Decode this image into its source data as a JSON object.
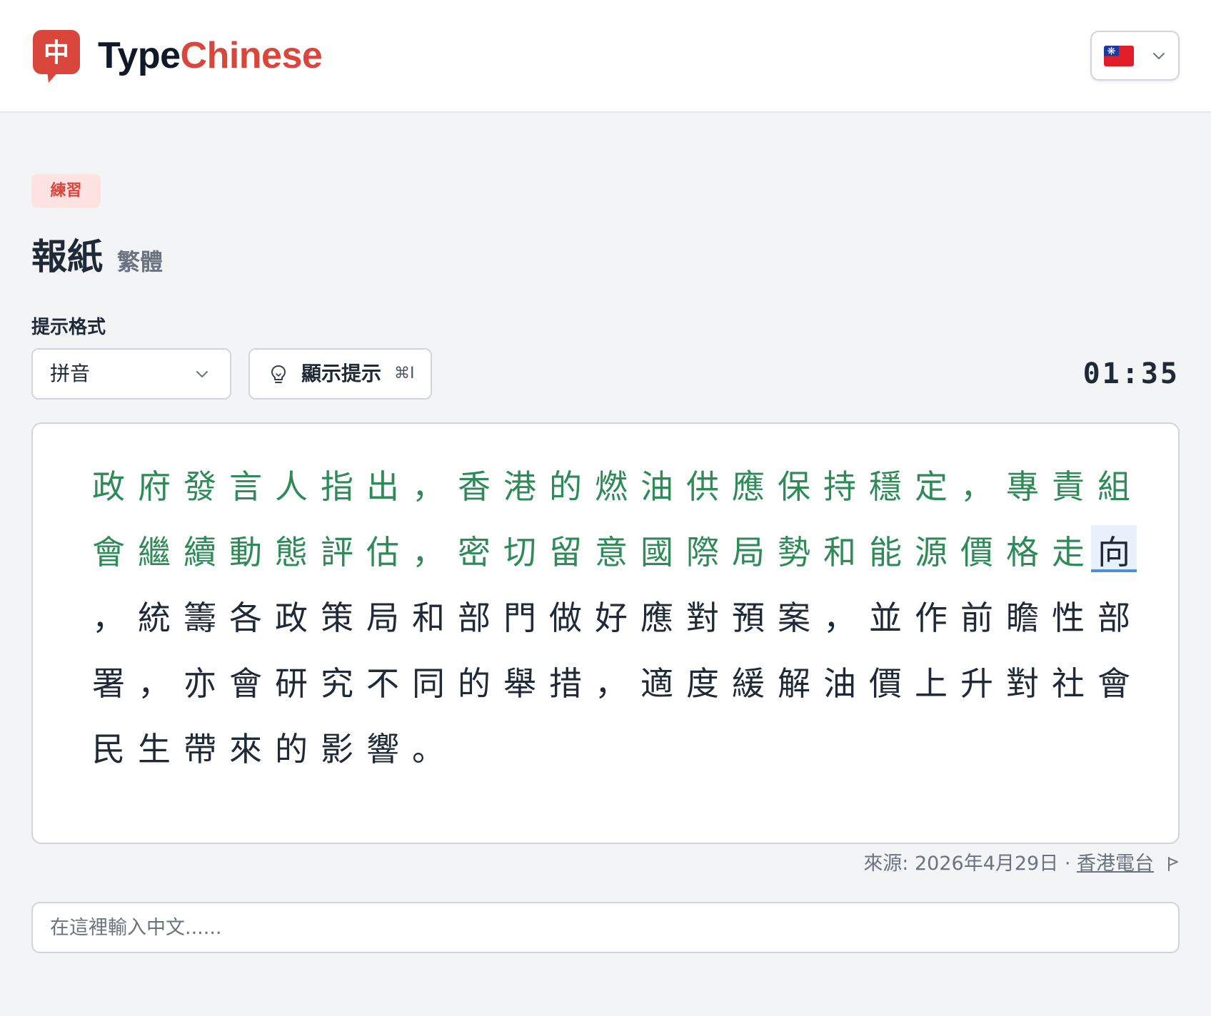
{
  "app": {
    "logo_glyph": "中",
    "name_part1": "Type",
    "name_part2": "Chinese",
    "brand_color": "#d9463b"
  },
  "language_selector": {
    "flag": "taiwan-flag-icon"
  },
  "badge": "練習",
  "title": "報紙",
  "subtitle": "繁體",
  "hint_format": {
    "label": "提示格式",
    "selected": "拼音"
  },
  "hint_button": {
    "label": "顯示提示",
    "shortcut": "⌘I"
  },
  "timer": "01:35",
  "passage": {
    "typed_color": "#2e8b57",
    "current_index": 45,
    "chars": [
      "政",
      "府",
      "發",
      "言",
      "人",
      "指",
      "出",
      "，",
      "香",
      "港",
      "的",
      "燃",
      "油",
      "供",
      "應",
      "保",
      "持",
      "穩",
      "定",
      "，",
      "專",
      "責",
      "組",
      "會",
      "繼",
      "續",
      "動",
      "態",
      "評",
      "估",
      "，",
      "密",
      "切",
      "留",
      "意",
      "國",
      "際",
      "局",
      "勢",
      "和",
      "能",
      "源",
      "價",
      "格",
      "走",
      "向",
      "，",
      "統",
      "籌",
      "各",
      "政",
      "策",
      "局",
      "和",
      "部",
      "門",
      "做",
      "好",
      "應",
      "對",
      "預",
      "案",
      "，",
      "並",
      "作",
      "前",
      "瞻",
      "性",
      "部",
      "署",
      "，",
      "亦",
      "會",
      "研",
      "究",
      "不",
      "同",
      "的",
      "舉",
      "措",
      "，",
      "適",
      "度",
      "緩",
      "解",
      "油",
      "價",
      "上",
      "升",
      "對",
      "社",
      "會",
      "民",
      "生",
      "帶",
      "來",
      "的",
      "影",
      "響",
      "。"
    ]
  },
  "source": {
    "prefix": "來源: 2026年4月29日 · ",
    "link": "香港電台"
  },
  "input": {
    "placeholder": "在這裡輸入中文......",
    "value": ""
  }
}
